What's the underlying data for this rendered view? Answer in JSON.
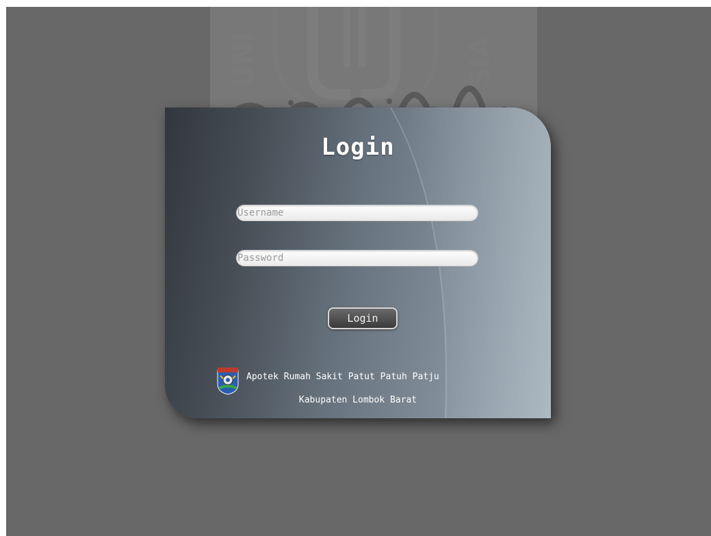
{
  "login": {
    "title": "Login",
    "username_placeholder": "Username",
    "password_placeholder": "Password",
    "button_label": "Login"
  },
  "footer": {
    "line1": "Apotek Rumah Sakit Patut Patuh Patju",
    "line2": "Kabupaten Lombok Barat"
  },
  "watermark": {
    "letters_left": "UNI",
    "letters_right": "SIA"
  },
  "colors": {
    "page_background": "#686868",
    "card_dark": "#32373d",
    "card_light": "#9aa9b5",
    "text": "#ffffff"
  },
  "icons": [
    "university-watermark",
    "district-crest-icon"
  ]
}
